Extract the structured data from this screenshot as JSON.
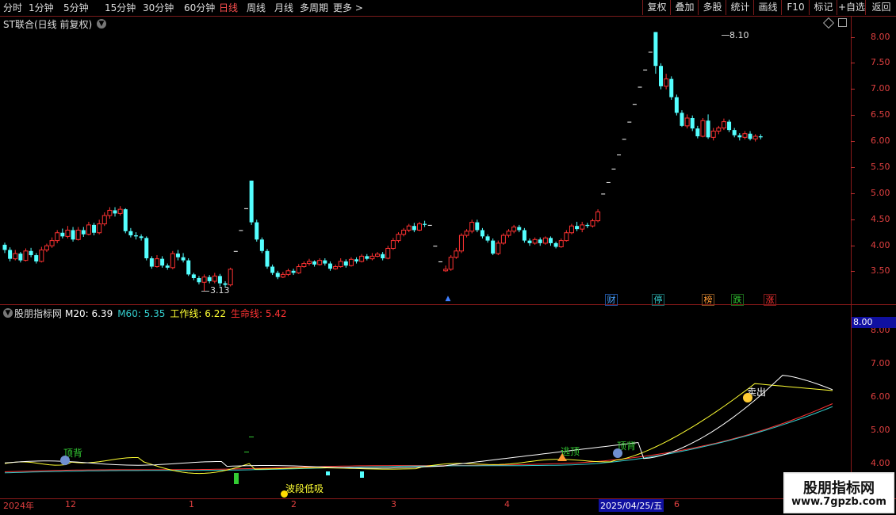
{
  "toolbar": {
    "periods": [
      "分时",
      "1分钟",
      "5分钟",
      "15分钟",
      "30分钟",
      "60分钟",
      "日线",
      "周线",
      "月线",
      "多周期",
      "更多 >"
    ],
    "active_period": "日线",
    "right_buttons": [
      "复权",
      "叠加",
      "多股",
      "统计",
      "画线",
      "F10",
      "标记",
      "+自选",
      "返回"
    ]
  },
  "main_panel": {
    "title": "ST联合(日线 前复权)",
    "y_axis_labels": [
      "8.00",
      "7.50",
      "7.00",
      "6.50",
      "6.00",
      "5.50",
      "5.00",
      "4.50",
      "4.00",
      "3.50"
    ],
    "high_label": "8.10",
    "low_label": "3.13",
    "event_tags": [
      {
        "text": "财",
        "color": "#4aa3ff"
      },
      {
        "text": "停",
        "color": "#33cccc"
      },
      {
        "text": "榜",
        "color": "#ff9933"
      },
      {
        "text": "跌",
        "color": "#33cc33"
      },
      {
        "text": "涨",
        "color": "#ff3333"
      }
    ],
    "arrow_glyph": "▲"
  },
  "indicator_panel": {
    "name": "股朋指标网",
    "values": [
      {
        "label": "M20:",
        "value": "6.39",
        "color": "#ffffff"
      },
      {
        "label": "M60:",
        "value": "5.35",
        "color": "#33cccc"
      },
      {
        "label": "工作线:",
        "value": "6.22",
        "color": "#ffff33"
      },
      {
        "label": "生命线:",
        "value": "5.42",
        "color": "#ff3333"
      }
    ],
    "current_value_box": "8.00",
    "y_axis_labels": [
      "8.00",
      "7.00",
      "6.00",
      "5.00",
      "4.00"
    ],
    "signals": [
      {
        "text": "顶背",
        "color": "#33cc33"
      },
      {
        "text": "波段低吸",
        "color": "#ffff33"
      },
      {
        "text": "逃顶",
        "color": "#33cc33"
      },
      {
        "text": "顶背",
        "color": "#33cc33"
      },
      {
        "text": "卖出",
        "color": "#ffffff"
      }
    ]
  },
  "date_axis": {
    "labels": [
      "2024年",
      "12",
      "1",
      "2",
      "3",
      "4",
      "2025/04/25/五",
      "6"
    ]
  },
  "watermark": {
    "line1": "股朋指标网",
    "line2": "www.7gpzb.com"
  },
  "chart_data": {
    "type": "candlestick",
    "ylim": [
      3.0,
      8.3
    ],
    "candles": [
      [
        4.02,
        3.92,
        4.06,
        3.86
      ],
      [
        3.92,
        3.75,
        3.97,
        3.7
      ],
      [
        3.75,
        3.85,
        3.92,
        3.72
      ],
      [
        3.85,
        3.72,
        3.88,
        3.68
      ],
      [
        3.72,
        3.9,
        3.95,
        3.7
      ],
      [
        3.9,
        3.82,
        3.96,
        3.78
      ],
      [
        3.82,
        3.7,
        3.86,
        3.66
      ],
      [
        3.7,
        3.92,
        3.98,
        3.68
      ],
      [
        3.92,
        4.0,
        4.04,
        3.88
      ],
      [
        4.0,
        4.1,
        4.16,
        3.96
      ],
      [
        4.1,
        4.25,
        4.3,
        4.05
      ],
      [
        4.25,
        4.18,
        4.33,
        4.14
      ],
      [
        4.18,
        4.3,
        4.38,
        4.14
      ],
      [
        4.3,
        4.12,
        4.36,
        4.08
      ],
      [
        4.12,
        4.3,
        4.36,
        4.1
      ],
      [
        4.3,
        4.22,
        4.36,
        4.17
      ],
      [
        4.22,
        4.4,
        4.46,
        4.2
      ],
      [
        4.4,
        4.25,
        4.44,
        4.2
      ],
      [
        4.25,
        4.42,
        4.5,
        4.22
      ],
      [
        4.42,
        4.58,
        4.64,
        4.38
      ],
      [
        4.58,
        4.68,
        4.74,
        4.52
      ],
      [
        4.68,
        4.62,
        4.74,
        4.56
      ],
      [
        4.62,
        4.7,
        4.76,
        4.58
      ],
      [
        4.7,
        4.28,
        4.72,
        4.24
      ],
      [
        4.28,
        4.2,
        4.34,
        4.16
      ],
      [
        4.2,
        4.18,
        4.26,
        4.12
      ],
      [
        4.18,
        4.15,
        4.22,
        4.1
      ],
      [
        4.15,
        3.76,
        4.18,
        3.72
      ],
      [
        3.76,
        3.6,
        3.8,
        3.56
      ],
      [
        3.6,
        3.75,
        3.82,
        3.58
      ],
      [
        3.75,
        3.62,
        3.8,
        3.58
      ],
      [
        3.62,
        3.58,
        3.66,
        3.54
      ],
      [
        3.58,
        3.85,
        3.9,
        3.55
      ],
      [
        3.85,
        3.78,
        3.92,
        3.72
      ],
      [
        3.78,
        3.72,
        3.86,
        3.68
      ],
      [
        3.72,
        3.45,
        3.76,
        3.42
      ],
      [
        3.45,
        3.38,
        3.48,
        3.34
      ],
      [
        3.38,
        3.3,
        3.42,
        3.26
      ],
      [
        3.3,
        3.4,
        3.45,
        3.13
      ],
      [
        3.4,
        3.32,
        3.44,
        3.28
      ],
      [
        3.32,
        3.42,
        3.48,
        3.28
      ],
      [
        3.42,
        3.28,
        3.46,
        3.22
      ],
      [
        3.28,
        3.25,
        3.32,
        3.2
      ],
      [
        3.25,
        3.55,
        3.58,
        3.22
      ],
      [
        3.9,
        3.9,
        3.9,
        3.9
      ],
      [
        4.3,
        4.3,
        4.3,
        4.3
      ],
      [
        4.72,
        4.72,
        4.72,
        4.72
      ],
      [
        5.25,
        4.45,
        5.25,
        4.4
      ],
      [
        4.45,
        4.12,
        4.5,
        4.08
      ],
      [
        4.12,
        3.9,
        4.16,
        3.86
      ],
      [
        3.9,
        3.6,
        3.94,
        3.56
      ],
      [
        3.6,
        3.48,
        3.64,
        3.44
      ],
      [
        3.48,
        3.4,
        3.52,
        3.36
      ],
      [
        3.4,
        3.45,
        3.5,
        3.38
      ],
      [
        3.45,
        3.52,
        3.56,
        3.42
      ],
      [
        3.52,
        3.48,
        3.56,
        3.44
      ],
      [
        3.48,
        3.6,
        3.65,
        3.46
      ],
      [
        3.6,
        3.66,
        3.7,
        3.58
      ],
      [
        3.66,
        3.7,
        3.75,
        3.62
      ],
      [
        3.7,
        3.64,
        3.72,
        3.6
      ],
      [
        3.64,
        3.72,
        3.76,
        3.62
      ],
      [
        3.72,
        3.66,
        3.76,
        3.62
      ],
      [
        3.66,
        3.56,
        3.7,
        3.52
      ],
      [
        3.56,
        3.6,
        3.64,
        3.54
      ],
      [
        3.6,
        3.7,
        3.76,
        3.58
      ],
      [
        3.7,
        3.62,
        3.74,
        3.58
      ],
      [
        3.62,
        3.74,
        3.78,
        3.6
      ],
      [
        3.74,
        3.7,
        3.78,
        3.66
      ],
      [
        3.7,
        3.8,
        3.84,
        3.68
      ],
      [
        3.8,
        3.75,
        3.84,
        3.72
      ],
      [
        3.75,
        3.8,
        3.86,
        3.72
      ],
      [
        3.8,
        3.84,
        3.88,
        3.78
      ],
      [
        3.84,
        3.76,
        3.88,
        3.72
      ],
      [
        3.76,
        3.95,
        4.0,
        3.74
      ],
      [
        3.95,
        4.1,
        4.15,
        3.92
      ],
      [
        4.1,
        4.22,
        4.26,
        4.06
      ],
      [
        4.22,
        4.3,
        4.34,
        4.18
      ],
      [
        4.3,
        4.38,
        4.42,
        4.26
      ],
      [
        4.38,
        4.3,
        4.44,
        4.26
      ],
      [
        4.3,
        4.42,
        4.46,
        4.28
      ],
      [
        4.42,
        4.4,
        4.48,
        4.36
      ],
      [
        4.4,
        4.4,
        4.4,
        4.4
      ],
      [
        4.0,
        4.0,
        4.0,
        4.0
      ],
      [
        3.7,
        3.7,
        3.7,
        3.7
      ],
      [
        3.52,
        3.55,
        3.62,
        3.5
      ],
      [
        3.55,
        3.78,
        3.82,
        3.52
      ],
      [
        3.78,
        3.9,
        3.96,
        3.75
      ],
      [
        3.9,
        4.2,
        4.24,
        3.86
      ],
      [
        4.2,
        4.28,
        4.32,
        4.16
      ],
      [
        4.28,
        4.45,
        4.5,
        4.24
      ],
      [
        4.45,
        4.3,
        4.5,
        4.26
      ],
      [
        4.3,
        4.18,
        4.34,
        4.14
      ],
      [
        4.18,
        4.1,
        4.22,
        4.06
      ],
      [
        4.1,
        3.85,
        4.14,
        3.82
      ],
      [
        3.85,
        4.05,
        4.1,
        3.82
      ],
      [
        4.05,
        4.2,
        4.24,
        4.02
      ],
      [
        4.2,
        4.28,
        4.32,
        4.16
      ],
      [
        4.28,
        4.36,
        4.4,
        4.24
      ],
      [
        4.36,
        4.3,
        4.4,
        4.26
      ],
      [
        4.3,
        4.1,
        4.34,
        4.06
      ],
      [
        4.1,
        4.05,
        4.14,
        4.0
      ],
      [
        4.05,
        4.12,
        4.16,
        4.02
      ],
      [
        4.12,
        4.05,
        4.16,
        4.0
      ],
      [
        4.05,
        4.15,
        4.18,
        4.02
      ],
      [
        4.15,
        4.05,
        4.18,
        4.0
      ],
      [
        4.05,
        3.98,
        4.08,
        3.95
      ],
      [
        3.98,
        4.1,
        4.14,
        3.96
      ],
      [
        4.1,
        4.25,
        4.3,
        4.08
      ],
      [
        4.25,
        4.38,
        4.42,
        4.22
      ],
      [
        4.38,
        4.32,
        4.46,
        4.28
      ],
      [
        4.32,
        4.4,
        4.46,
        4.26
      ],
      [
        4.4,
        4.38,
        4.44,
        4.34
      ],
      [
        4.38,
        4.48,
        4.52,
        4.35
      ],
      [
        4.48,
        4.65,
        4.7,
        4.45
      ],
      [
        5.0,
        5.0,
        5.0,
        5.0
      ],
      [
        5.22,
        5.22,
        5.22,
        5.22
      ],
      [
        5.48,
        5.48,
        5.48,
        5.48
      ],
      [
        5.75,
        5.75,
        5.75,
        5.75
      ],
      [
        6.05,
        6.05,
        6.05,
        6.05
      ],
      [
        6.38,
        6.38,
        6.38,
        6.38
      ],
      [
        6.72,
        6.72,
        6.72,
        6.72
      ],
      [
        7.05,
        7.05,
        7.05,
        7.05
      ],
      [
        7.38,
        7.38,
        7.38,
        7.38
      ],
      [
        7.72,
        7.72,
        7.72,
        7.72
      ],
      [
        8.1,
        7.45,
        8.1,
        7.3
      ],
      [
        7.45,
        7.06,
        7.5,
        7.0
      ],
      [
        7.06,
        7.2,
        7.3,
        7.0
      ],
      [
        7.2,
        6.85,
        7.25,
        6.8
      ],
      [
        6.85,
        6.55,
        6.9,
        6.5
      ],
      [
        6.55,
        6.3,
        6.6,
        6.28
      ],
      [
        6.3,
        6.45,
        6.52,
        6.25
      ],
      [
        6.45,
        6.25,
        6.5,
        6.2
      ],
      [
        6.25,
        6.1,
        6.3,
        6.06
      ],
      [
        6.1,
        6.4,
        6.45,
        6.08
      ],
      [
        6.4,
        6.08,
        6.52,
        6.05
      ],
      [
        6.08,
        6.2,
        6.26,
        6.02
      ],
      [
        6.2,
        6.26,
        6.3,
        6.14
      ],
      [
        6.26,
        6.38,
        6.44,
        6.22
      ],
      [
        6.38,
        6.22,
        6.42,
        6.18
      ],
      [
        6.22,
        6.12,
        6.26,
        6.08
      ],
      [
        6.12,
        6.08,
        6.16,
        6.02
      ],
      [
        6.08,
        6.15,
        6.2,
        6.04
      ],
      [
        6.15,
        6.05,
        6.2,
        6.02
      ],
      [
        6.05,
        6.1,
        6.14,
        6.0
      ],
      [
        6.1,
        6.08,
        6.14,
        6.04
      ]
    ]
  }
}
